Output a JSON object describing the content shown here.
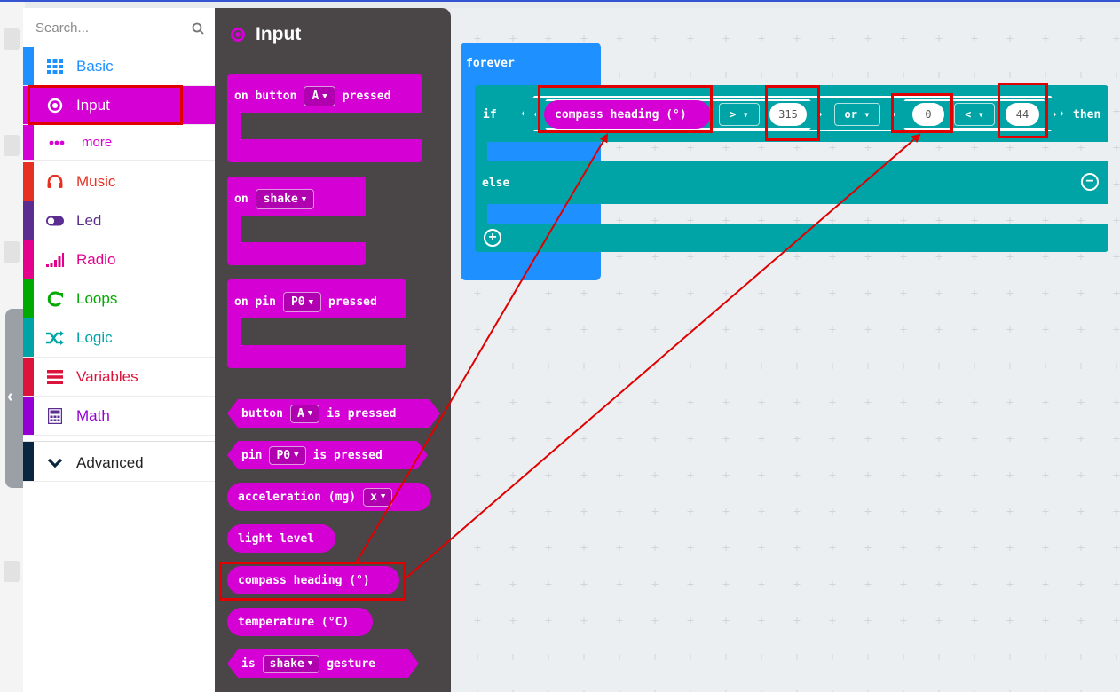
{
  "search": {
    "placeholder": "Search..."
  },
  "categories": [
    {
      "label": "Basic",
      "color": "#1e90ff",
      "icon": "grid-icon"
    },
    {
      "label": "Input",
      "color": "#d400d4",
      "icon": "target-icon"
    },
    {
      "label": "more",
      "color": "#d400d4",
      "icon": "dots-icon"
    },
    {
      "label": "Music",
      "color": "#e63022",
      "icon": "headphones-icon"
    },
    {
      "label": "Led",
      "color": "#5c2d91",
      "icon": "toggle-icon"
    },
    {
      "label": "Radio",
      "color": "#e3008c",
      "icon": "signal-icon"
    },
    {
      "label": "Loops",
      "color": "#00aa00",
      "icon": "loop-icon"
    },
    {
      "label": "Logic",
      "color": "#00a4a6",
      "icon": "shuffle-icon"
    },
    {
      "label": "Variables",
      "color": "#dc143c",
      "icon": "list-icon"
    },
    {
      "label": "Math",
      "color": "#9400d3",
      "icon": "calculator-icon"
    },
    {
      "label": "Advanced",
      "color": "#0a2540",
      "icon": "chevron-down-icon"
    }
  ],
  "flyout": {
    "title": "Input",
    "blocks": {
      "on_button": {
        "prefix": "on button",
        "dropdown": "A",
        "suffix": "pressed"
      },
      "on_shake": {
        "prefix": "on",
        "dropdown": "shake"
      },
      "on_pin": {
        "prefix": "on pin",
        "dropdown": "P0",
        "suffix": "pressed"
      },
      "button_is_pressed": {
        "prefix": "button",
        "dropdown": "A",
        "suffix": "is pressed"
      },
      "pin_is_pressed": {
        "prefix": "pin",
        "dropdown": "P0",
        "suffix": "is pressed"
      },
      "acceleration": {
        "prefix": "acceleration (mg)",
        "dropdown": "x"
      },
      "light_level": {
        "label": "light level"
      },
      "compass_heading": {
        "label": "compass heading (°)"
      },
      "temperature": {
        "label": "temperature (°C)"
      },
      "is_gesture": {
        "prefix": "is",
        "dropdown": "shake",
        "suffix": "gesture"
      }
    }
  },
  "workspace": {
    "forever_label": "forever",
    "if_label": "if",
    "compass": "compass heading (°)",
    "op1": "> ▾",
    "value1": "315",
    "or_label": "or ▾",
    "value2": "0",
    "op2": "< ▾",
    "value3": "44",
    "then_label": "then",
    "else_label": "else"
  },
  "colors": {
    "input": "#d400d4",
    "logic": "#00a4a6",
    "basic": "#1e90ff",
    "highlight": "#e00000"
  }
}
